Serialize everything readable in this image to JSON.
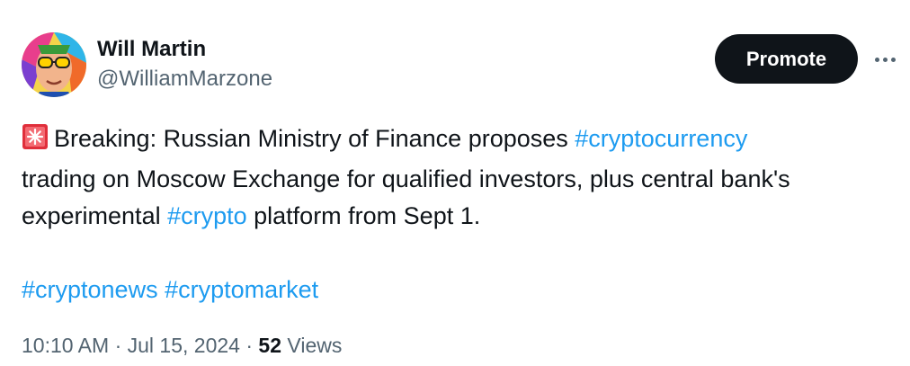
{
  "author": {
    "name": "Will Martin",
    "handle": "@WilliamMarzone"
  },
  "actions": {
    "promote_label": "Promote",
    "more_icon": "more-dots-icon"
  },
  "tweet": {
    "emoji": "siren-light",
    "line1_text": "Breaking: Russian Ministry of Finance proposes ",
    "line1_hashtag": "#cryptocurrency",
    "line2_text": "trading on Moscow Exchange for qualified investors, plus central bank's",
    "line3_prefix": "experimental ",
    "line3_hashtag": "#crypto",
    "line3_suffix": " platform from Sept 1.",
    "footer_hashtag_1": "#cryptonews",
    "footer_hashtag_2": "#cryptomarket"
  },
  "meta": {
    "time": "10:10 AM",
    "separator": "·",
    "date": "Jul 15, 2024",
    "views_count": "52",
    "views_label": "Views"
  },
  "colors": {
    "text": "#0f1419",
    "secondary": "#536471",
    "link": "#1d9bf0",
    "button_bg": "#0f1419"
  }
}
